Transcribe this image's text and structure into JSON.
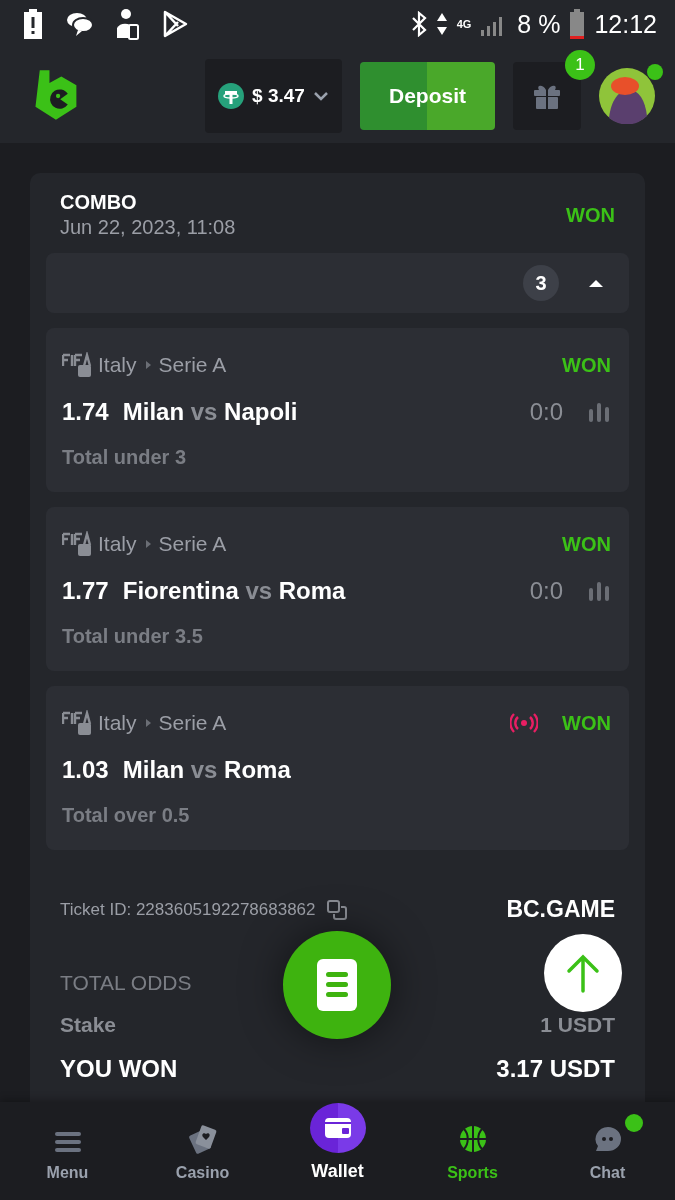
{
  "status_bar": {
    "network": "4G",
    "battery": "8 %",
    "time": "12:12"
  },
  "header": {
    "balance": "$ 3.47",
    "deposit": "Deposit",
    "gift_badge": "1",
    "avatar_online": true
  },
  "bet": {
    "type": "COMBO",
    "date": "Jun 22, 2023, 11:08",
    "result": "WON",
    "count": "3",
    "expanded": true,
    "selections": [
      {
        "country": "Italy",
        "league": "Serie A",
        "live": false,
        "result": "WON",
        "odds": "1.74",
        "home": "Milan",
        "vs": "vs",
        "away": "Napoli",
        "score": "0:0",
        "market": "Total under 3"
      },
      {
        "country": "Italy",
        "league": "Serie A",
        "live": false,
        "result": "WON",
        "odds": "1.77",
        "home": "Fiorentina",
        "vs": "vs",
        "away": "Roma",
        "score": "0:0",
        "market": "Total under 3.5"
      },
      {
        "country": "Italy",
        "league": "Serie A",
        "live": true,
        "result": "WON",
        "odds": "1.03",
        "home": "Milan",
        "vs": "vs",
        "away": "Roma",
        "market": "Total over 0.5"
      }
    ],
    "ticket": "Ticket ID: 2283605192278683862",
    "brand": "BC.GAME",
    "summary": [
      {
        "label": "TOTAL ODDS",
        "kind": "muted"
      },
      {
        "label": "Stake",
        "value": "1 USDT",
        "kind": "normal"
      },
      {
        "label": "YOU WON",
        "value": "3.17 USDT",
        "kind": "strong"
      }
    ]
  },
  "nav": [
    {
      "label": "Menu",
      "kind": "tab",
      "selected": false,
      "dot": false
    },
    {
      "label": "Casino",
      "kind": "tab",
      "selected": false,
      "dot": false
    },
    {
      "label": "Wallet",
      "kind": "raised",
      "selected": false,
      "dot": false
    },
    {
      "label": "Sports",
      "kind": "tab",
      "selected": true,
      "dot": false
    },
    {
      "label": "Chat",
      "kind": "tab",
      "selected": false,
      "dot": true
    }
  ]
}
